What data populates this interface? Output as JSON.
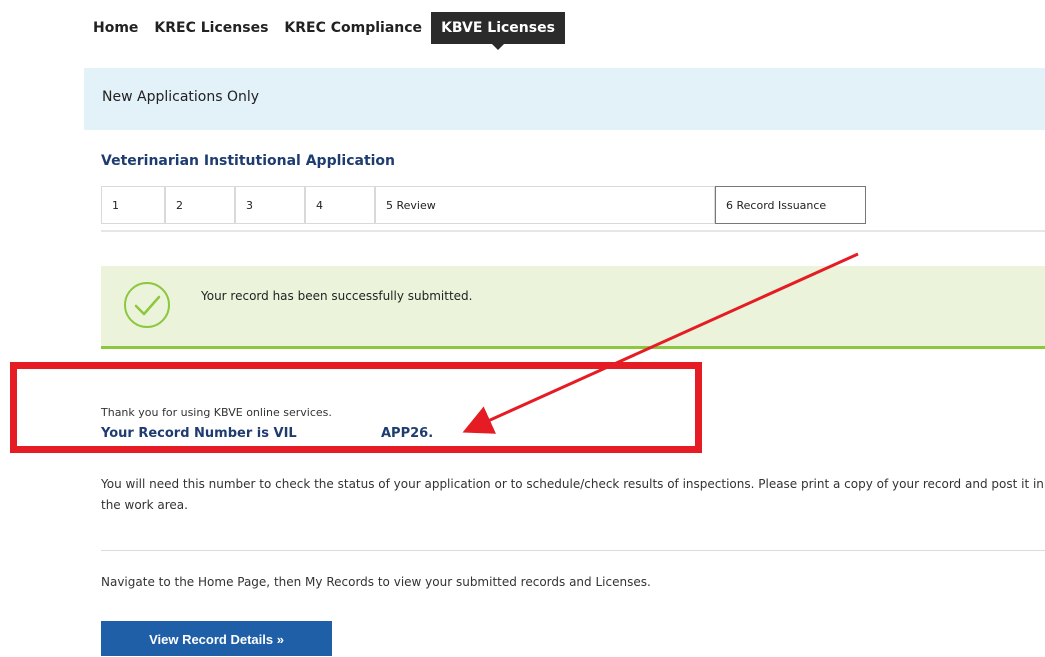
{
  "nav": {
    "items": [
      {
        "label": "Home"
      },
      {
        "label": "KREC Licenses"
      },
      {
        "label": "KREC Compliance"
      },
      {
        "label": "KBVE Licenses",
        "active": true
      }
    ]
  },
  "banner": {
    "text": "New Applications Only"
  },
  "application": {
    "title": "Veterinarian Institutional Application",
    "steps": [
      {
        "label": "1"
      },
      {
        "label": "2"
      },
      {
        "label": "3"
      },
      {
        "label": "4"
      },
      {
        "label": "5  Review"
      },
      {
        "label": "6  Record Issuance",
        "current": true
      }
    ]
  },
  "success": {
    "message": "Your record has been successfully submitted."
  },
  "confirmation": {
    "thanks": "Thank you for using KBVE online services.",
    "record_prefix": "Your Record Number is VIL",
    "record_suffix": "APP26."
  },
  "info_text": "You will need this number to check the status of your application or to schedule/check results of inspections. Please print a copy of your record and post it in the work area.",
  "navigate_text": "Navigate to the Home Page, then My Records to view your submitted records and Licenses.",
  "button": {
    "label": "View Record Details »"
  },
  "colors": {
    "accent": "#1e5fa8",
    "title_blue": "#1e3c70",
    "highlight_red": "#e51c23",
    "success_green": "#8dc63f"
  }
}
